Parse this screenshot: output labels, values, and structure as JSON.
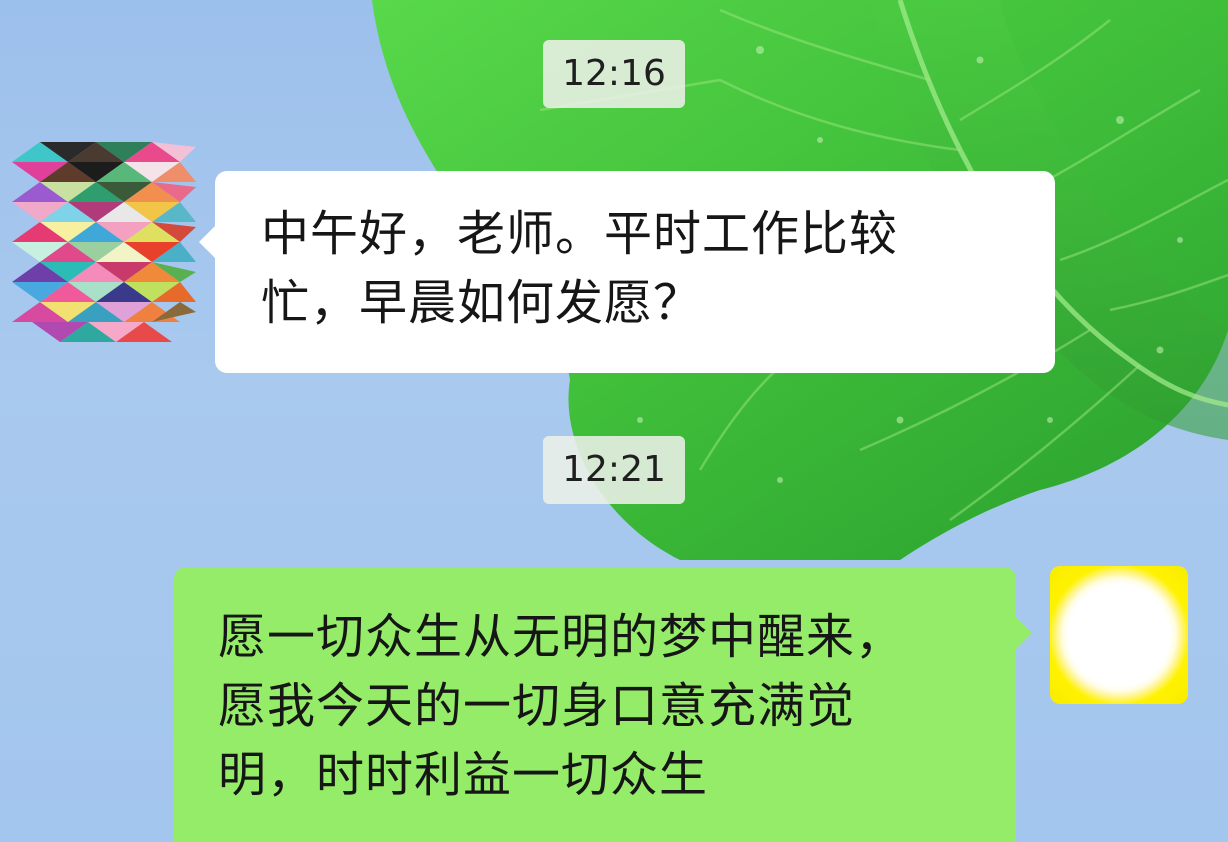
{
  "chat": {
    "messages": [
      {
        "type": "timestamp",
        "text": "12:16"
      },
      {
        "type": "incoming",
        "avatar": "geometric-pattern-avatar",
        "lines": [
          "中午好，老师。平时工作比较",
          "忙，早晨如何发愿？"
        ]
      },
      {
        "type": "timestamp",
        "text": "12:21"
      },
      {
        "type": "outgoing",
        "avatar": "sun-avatar",
        "lines": [
          "愿一切众生从无明的梦中醒来，",
          "愿我今天的一切身口意充满觉",
          "明，时时利益一切众生"
        ]
      }
    ]
  },
  "colors": {
    "incoming_bubble": "#ffffff",
    "outgoing_bubble": "#95ec69",
    "timestamp_bg": "#ecf0e8",
    "wallpaper_sky": "#a9c9ee",
    "wallpaper_leaf": "#3fbe3a"
  },
  "wallpaper": "green-leaf-on-blue-sky"
}
